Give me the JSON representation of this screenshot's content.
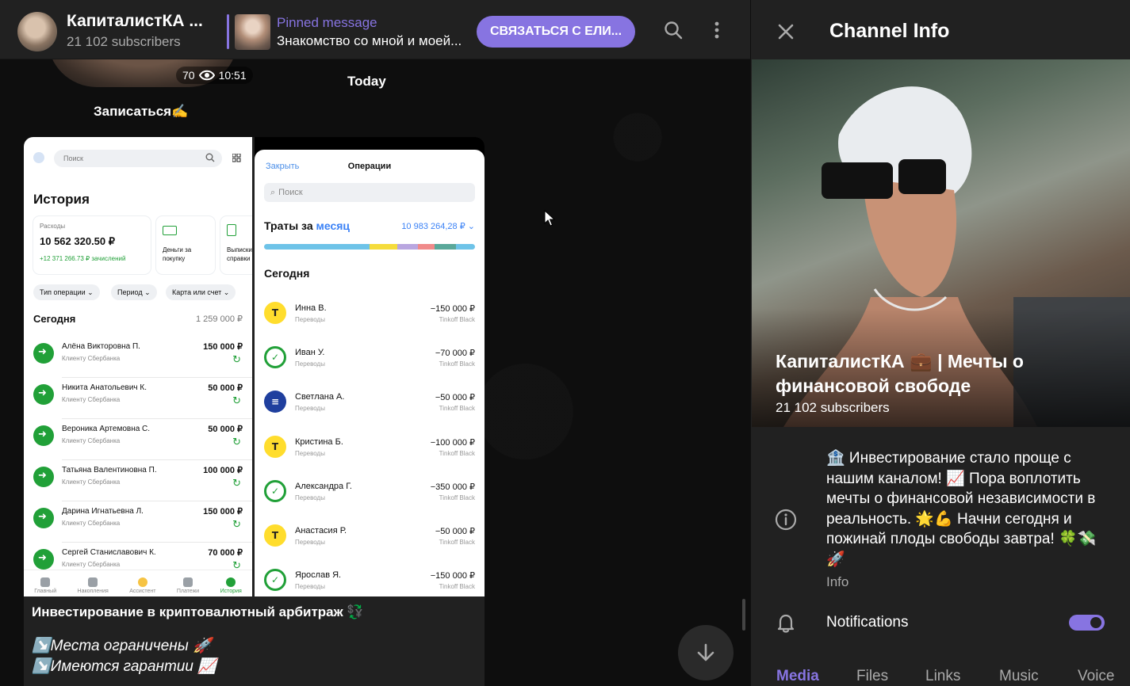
{
  "header": {
    "channel_title": "КапиталистКА ...",
    "subscribers": "21 102 subscribers",
    "pinned_label": "Pinned message",
    "pinned_text": "Знакомство со мной и моей...",
    "contact_button": "СВЯЗАТЬСЯ С ЕЛИ...",
    "icons": [
      "search-icon",
      "more-vertical-icon"
    ]
  },
  "chat": {
    "prev_views": "70",
    "prev_time": "10:51",
    "date_separator": "Today",
    "signup_text": "Записаться✍️",
    "screenshot_left": {
      "search": "Поиск",
      "heading": "История",
      "card_expenses_label": "Расходы",
      "card_expenses_value": "10 562 320.50 ₽",
      "card_expenses_income": "+12 371 266.73 ₽ зачислений",
      "card_money_label": "Деньги за покупку",
      "card_extract_label": "Выписки и справки",
      "chips": [
        "Тип операции ⌄",
        "Период ⌄",
        "Карта или счет ⌄"
      ],
      "today": "Сегодня",
      "today_sum": "1 259 000 ₽",
      "rows": [
        {
          "name": "Алёна Викторовна П.",
          "desc": "Клиенту Сбербанка",
          "amount": "150 000 ₽"
        },
        {
          "name": "Никита Анатольевич К.",
          "desc": "Клиенту Сбербанка",
          "amount": "50 000 ₽"
        },
        {
          "name": "Вероника Артемовна С.",
          "desc": "Клиенту Сбербанка",
          "amount": "50 000 ₽"
        },
        {
          "name": "Татьяна Валентиновна П.",
          "desc": "Клиенту Сбербанка",
          "amount": "100 000 ₽"
        },
        {
          "name": "Дарина Игнатьевна Л.",
          "desc": "Клиенту Сбербанка",
          "amount": "150 000 ₽"
        },
        {
          "name": "Сергей Станиславович К.",
          "desc": "Клиенту Сбербанка",
          "amount": "70 000 ₽"
        }
      ],
      "tabs": [
        "Главный",
        "Накопления",
        "Ассистент",
        "Платежи",
        "История"
      ]
    },
    "screenshot_right": {
      "close": "Закрыть",
      "title": "Операции",
      "search": "Поиск",
      "spend_prefix": "Траты за ",
      "spend_period": "месяц",
      "spend_total": "10 983 264,28 ₽ ⌄",
      "bar_colors": [
        "#6ec3e8",
        "#f5dc3c",
        "#b9a6e0",
        "#f08a8a",
        "#5aa89a",
        "#6ec3e8"
      ],
      "today": "Сегодня",
      "rows": [
        {
          "name": "Инна В.",
          "desc": "Переводы",
          "amount": "−150 000 ₽",
          "card": "Tinkoff Black",
          "icon": "tinkoff"
        },
        {
          "name": "Иван У.",
          "desc": "Переводы",
          "amount": "−70 000 ₽",
          "card": "Tinkoff Black",
          "icon": "sber"
        },
        {
          "name": "Светлана А.",
          "desc": "Переводы",
          "amount": "−50 000 ₽",
          "card": "Tinkoff Black",
          "icon": "vtb"
        },
        {
          "name": "Кристина Б.",
          "desc": "Переводы",
          "amount": "−100 000 ₽",
          "card": "Tinkoff Black",
          "icon": "tinkoff"
        },
        {
          "name": "Александра Г.",
          "desc": "Переводы",
          "amount": "−350 000 ₽",
          "card": "Tinkoff Black",
          "icon": "sber"
        },
        {
          "name": "Анастасия Р.",
          "desc": "Переводы",
          "amount": "−50 000 ₽",
          "card": "Tinkoff Black",
          "icon": "tinkoff"
        },
        {
          "name": "Ярослав Я.",
          "desc": "Переводы",
          "amount": "−150 000 ₽",
          "card": "Tinkoff Black",
          "icon": "sber"
        }
      ]
    },
    "caption_title": "Инвестирование в криптовалютный арбитраж 💱",
    "caption_lines": [
      "↘️Места ограничены 🚀",
      "↘️Имеются гарантии 📈"
    ]
  },
  "info": {
    "title": "Channel Info",
    "channel_name": "КапиталистКА 💼 | Мечты о финансовой свободе",
    "subscribers": "21 102 subscribers",
    "description": "🏦 Инвестирование стало проще с нашим каналом! 📈 Пора воплотить мечты о финансовой независимости в реальность. 🌟💪 Начни сегодня и пожинай плоды свободы завтра! 🍀💸🚀",
    "description_label": "Info",
    "notifications_label": "Notifications",
    "notifications_on": true,
    "tabs": [
      "Media",
      "Files",
      "Links",
      "Music",
      "Voice"
    ],
    "accent": "#8774e1"
  }
}
